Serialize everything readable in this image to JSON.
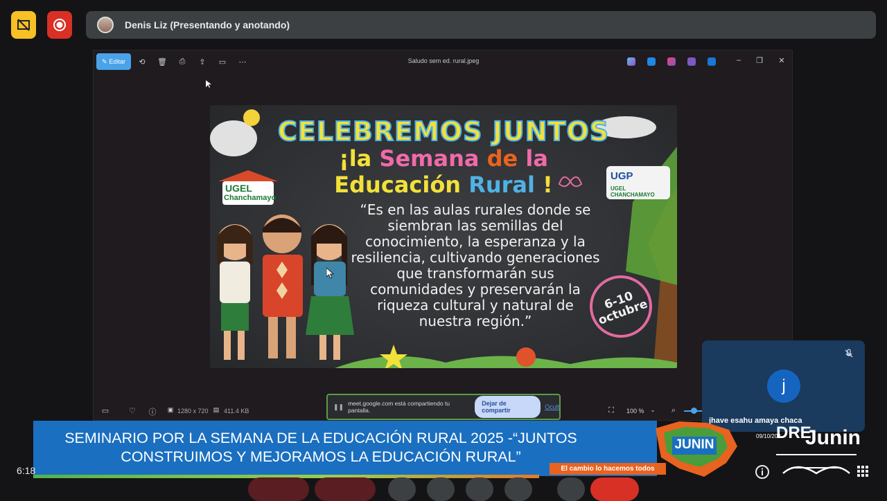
{
  "meet": {
    "presenter_label": "Denis Liz (Presentando y anotando)",
    "clock": "6:18",
    "participant": {
      "initial": "j",
      "name": "jhave esahu amaya chaca",
      "date": "09/10/202"
    },
    "share_notice": {
      "text": "meet.google.com está compartiendo tu pantalla.",
      "stop_label": "Dejar de compartir",
      "hide_label": "Ocultar"
    }
  },
  "viewer": {
    "edit_label": "Editar",
    "file_title": "Saludo sem ed. rural.jpeg",
    "dimensions": "1280 x 720",
    "file_size": "411.4 KB",
    "zoom": "100 %"
  },
  "poster": {
    "title1": "CELEBREMOS JUNTOS",
    "title2_a": "¡la ",
    "title2_b": "Semana ",
    "title2_c": "de ",
    "title2_d": "la",
    "title3_a": "Educación ",
    "title3_b": "Rural",
    "title3_c": " !",
    "quote": "“Es en las aulas rurales donde se siembran las semillas del conocimiento, la esperanza y la resiliencia, cultivando generaciones que transformarán sus comunidades y preservarán la riqueza cultural y natural de nuestra región.”",
    "logo_left_line1": "UGEL",
    "logo_left_line2": "Chanchamayo",
    "logo_right_line1": "UGP",
    "logo_right_line2": "UGEL CHANCHAMAYO",
    "date_line1": "6-10",
    "date_line2": "octubre"
  },
  "banner": {
    "line1": "SEMINARIO POR LA SEMANA DE LA EDUCACIÓN RURAL 2025 -“JUNTOS",
    "line2": "CONSTRUIMOS Y MEJORAMOS LA EDUCACIÓN RURAL”",
    "slogan": "El cambio lo hacemos todos",
    "region_logo_text": "JUNIN",
    "dre_logo_line1": "DRE",
    "dre_logo_line2": "Junin"
  },
  "colors": {
    "banner_blue": "#1a6fc0",
    "slogan_orange": "#e8631f",
    "hide_btn": "#f6c026",
    "record_btn": "#d93025",
    "edit_btn": "#4aa3e8"
  },
  "icons": [
    "hide-self-icon",
    "record-icon",
    "rotate-icon",
    "delete-icon",
    "print-icon",
    "share-icon",
    "slideshow-icon",
    "more-icon",
    "minimize-icon",
    "maximize-icon",
    "close-icon",
    "microphone-off-icon",
    "info-icon",
    "apps-grid-icon"
  ]
}
